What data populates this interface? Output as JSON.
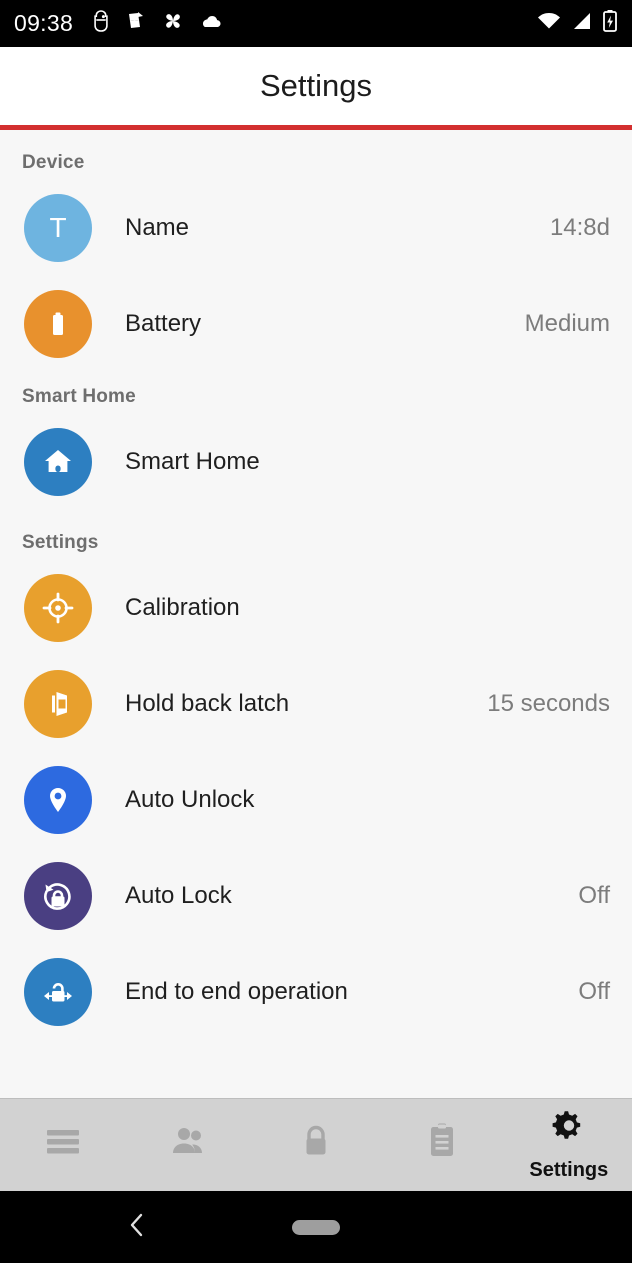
{
  "statusbar": {
    "time": "09:38",
    "notification_icons": [
      "bug-icon",
      "flag-arrow-icon",
      "pinwheel-icon",
      "cloud-icon"
    ],
    "system_icons": [
      "wifi-icon",
      "cellular-signal-icon",
      "battery-charging-icon"
    ]
  },
  "header": {
    "title": "Settings",
    "accent_color": "#d32f2f"
  },
  "sections": [
    {
      "header": "Device",
      "items": [
        {
          "label": "Name",
          "value": "14:8d",
          "icon": "letter-t-avatar-icon",
          "icon_color": "#6eb4e0"
        },
        {
          "label": "Battery",
          "value": "Medium",
          "icon": "battery-icon",
          "icon_color": "#e8912d"
        }
      ]
    },
    {
      "header": "Smart Home",
      "items": [
        {
          "label": "Smart Home",
          "value": "",
          "icon": "home-icon",
          "icon_color": "#2d7fc1"
        }
      ]
    },
    {
      "header": "Settings",
      "items": [
        {
          "label": "Calibration",
          "value": "",
          "icon": "crosshair-icon",
          "icon_color": "#e8a02d"
        },
        {
          "label": "Hold back latch",
          "value": "15 seconds",
          "icon": "open-door-icon",
          "icon_color": "#e8a02d"
        },
        {
          "label": "Auto Unlock",
          "value": "",
          "icon": "map-pin-icon",
          "icon_color": "#2d6ae0"
        },
        {
          "label": "Auto Lock",
          "value": "Off",
          "icon": "lock-rotate-icon",
          "icon_color": "#4a3f82"
        },
        {
          "label": "End to end operation",
          "value": "Off",
          "icon": "lock-arrows-icon",
          "icon_color": "#2d7fc1"
        }
      ]
    }
  ],
  "bottom_nav": {
    "tabs": [
      {
        "label": "",
        "icon": "hamburger-menu-icon",
        "active": false
      },
      {
        "label": "",
        "icon": "people-icon",
        "active": false
      },
      {
        "label": "",
        "icon": "lock-icon",
        "active": false
      },
      {
        "label": "",
        "icon": "clipboard-icon",
        "active": false
      },
      {
        "label": "Settings",
        "icon": "gear-icon",
        "active": true
      }
    ]
  },
  "android_nav": {
    "back": "back-chevron-icon",
    "home": "home-pill-icon"
  }
}
